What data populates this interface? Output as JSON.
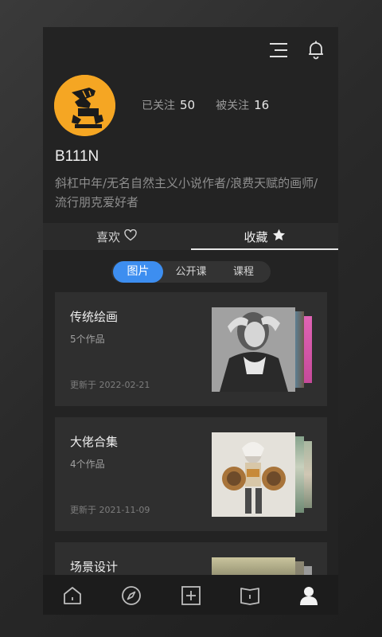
{
  "header": {
    "menu_icon": "menu-icon",
    "bell_icon": "bell-icon"
  },
  "profile": {
    "following_label": "已关注",
    "following_count": "50",
    "followers_label": "被关注",
    "followers_count": "16",
    "username": "B111N",
    "bio": "斜杠中年/无名自然主义小说作者/浪费天赋的画师/流行朋克爱好者"
  },
  "tabs": [
    {
      "label": "喜欢",
      "icon": "heart-outline-icon"
    },
    {
      "label": "收藏",
      "icon": "star-filled-icon",
      "selected": true
    }
  ],
  "segments": [
    {
      "label": "图片",
      "selected": true
    },
    {
      "label": "公开课"
    },
    {
      "label": "课程"
    }
  ],
  "collections": [
    {
      "title": "传统绘画",
      "count": "5个作品",
      "updated": "更新于 2022-02-21"
    },
    {
      "title": "大佬合集",
      "count": "4个作品",
      "updated": "更新于 2021-11-09"
    },
    {
      "title": "场景设计",
      "count": "",
      "updated": ""
    }
  ],
  "bottom_nav": [
    "home-icon",
    "compass-icon",
    "add-square-icon",
    "book-icon",
    "profile-icon"
  ],
  "colors": {
    "accent": "#3d8ef0",
    "avatar_bg": "#f5a623",
    "background": "#232323"
  }
}
